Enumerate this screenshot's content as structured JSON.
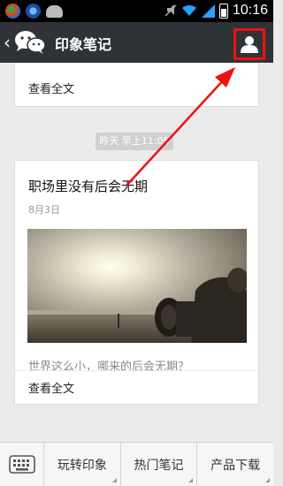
{
  "status_bar": {
    "time": "10:16"
  },
  "header": {
    "title": "印象笔记",
    "back_symbol": "‹"
  },
  "feed": {
    "prev_card": {
      "read_more": "查看全文"
    },
    "timestamp": "昨天 早上11:05",
    "article": {
      "title": "职场里没有后会无期",
      "date": "8月3日",
      "digest": "世界这么小，哪来的后会无期？",
      "read_more": "查看全文"
    }
  },
  "bottom_menu": {
    "items": [
      {
        "label": "玩转印象"
      },
      {
        "label": "热门笔记"
      },
      {
        "label": "产品下载"
      }
    ]
  },
  "colors": {
    "title_bar": "#2f3237",
    "highlight": "#e11111",
    "background": "#ebebeb"
  }
}
